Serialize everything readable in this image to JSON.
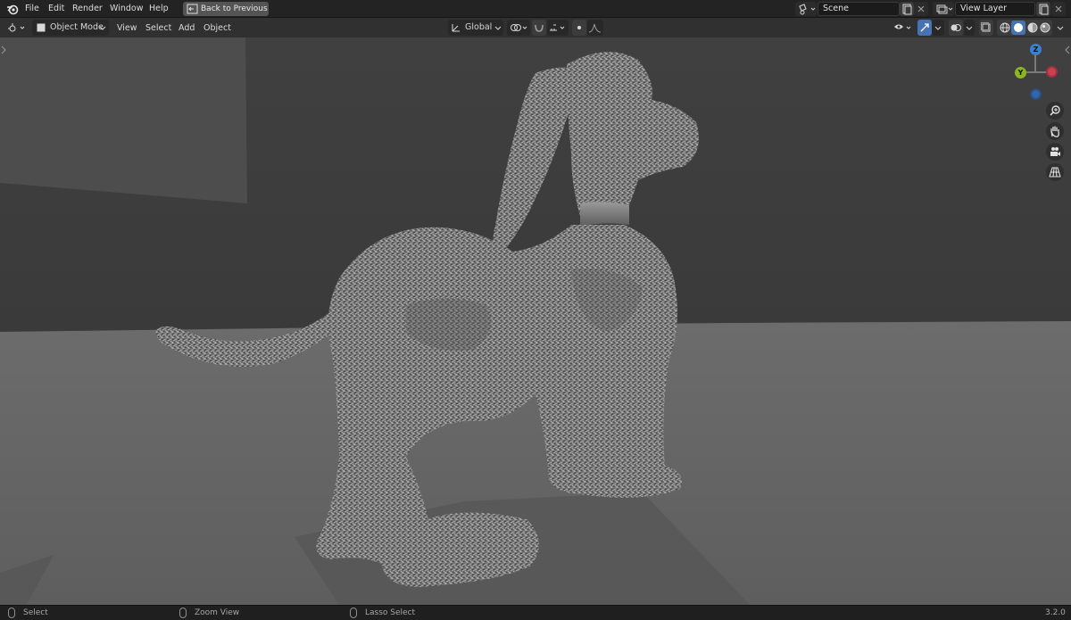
{
  "menu": {
    "items": [
      "File",
      "Edit",
      "Render",
      "Window",
      "Help"
    ],
    "back_label": "Back to Previous"
  },
  "scene": {
    "name": "Scene",
    "view_layer": "View Layer"
  },
  "header": {
    "mode": "Object Mode",
    "menus": [
      "View",
      "Select",
      "Add",
      "Object"
    ],
    "orientation": "Global"
  },
  "gizmo": {
    "z_label": "Z",
    "y_label": "Y"
  },
  "status": {
    "select": "Select",
    "zoom": "Zoom View",
    "lasso": "Lasso Select",
    "version": "3.2.0"
  },
  "colors": {
    "x_axis": "#c8424f",
    "y_axis": "#8ab71f",
    "z_axis": "#3a80d0",
    "active_blue": "#4772b3"
  },
  "icons": [
    "blender-logo-icon",
    "back-arrow-icon",
    "scene-icon",
    "view-layer-icon",
    "editor-type-icon",
    "object-mode-icon",
    "transform-orientation-icon",
    "pivot-icon",
    "snap-icon",
    "proportional-edit-icon",
    "visibility-icon",
    "gizmo-icon",
    "overlay-icon",
    "xray-icon",
    "wireframe-shading-icon",
    "solid-shading-icon",
    "material-shading-icon",
    "rendered-shading-icon",
    "zoom-icon",
    "hand-icon",
    "camera-icon",
    "grid-icon",
    "mouse-icon"
  ]
}
